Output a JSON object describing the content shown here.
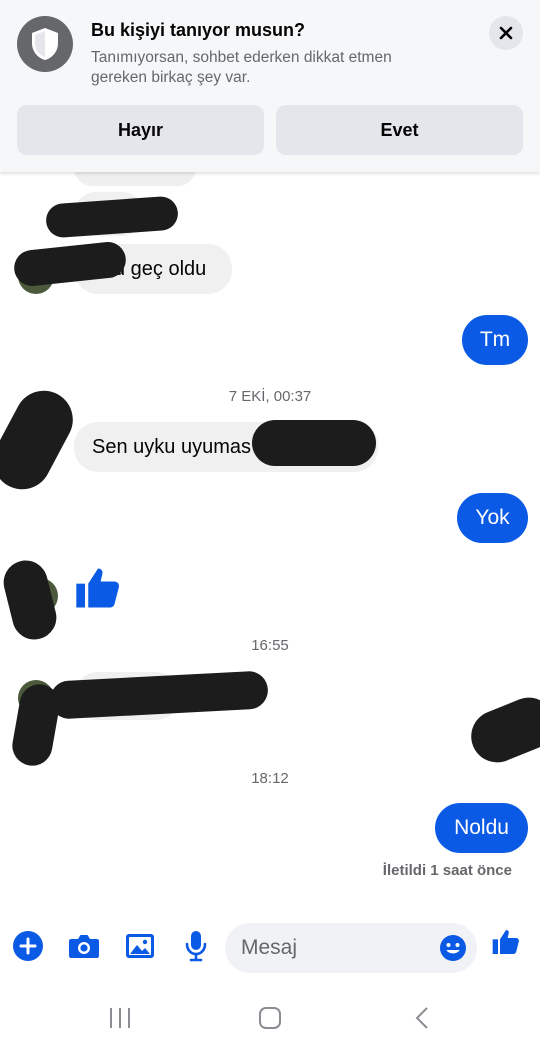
{
  "banner": {
    "title": "Bu kişiyi tanıyor musun?",
    "subtitle": "Tanımıyorsan, sohbet ederken dikkat etmen gereken birkaç şey var.",
    "no_label": "Hayır",
    "yes_label": "Evet",
    "icon": "shield-icon",
    "close_icon": "close-icon"
  },
  "messages": {
    "in_1": "u geç oldu",
    "out_1": "Tm",
    "timestamp_1": "7 EKİ, 00:37",
    "in_2": "Sen uyku uyumas",
    "out_2": "Yok",
    "timestamp_2": "16:55",
    "timestamp_3": "18:12",
    "out_3": "Noldu",
    "delivered": "İletildi 1 saat önce"
  },
  "composer": {
    "placeholder": "Mesaj",
    "icons": [
      "plus-icon",
      "camera-icon",
      "image-icon",
      "microphone-icon",
      "emoji-icon",
      "thumbs-up-icon"
    ]
  },
  "colors": {
    "accent": "#0a5ae6",
    "incoming_bubble": "#f0f0f0",
    "secondary_text": "#65676b"
  }
}
